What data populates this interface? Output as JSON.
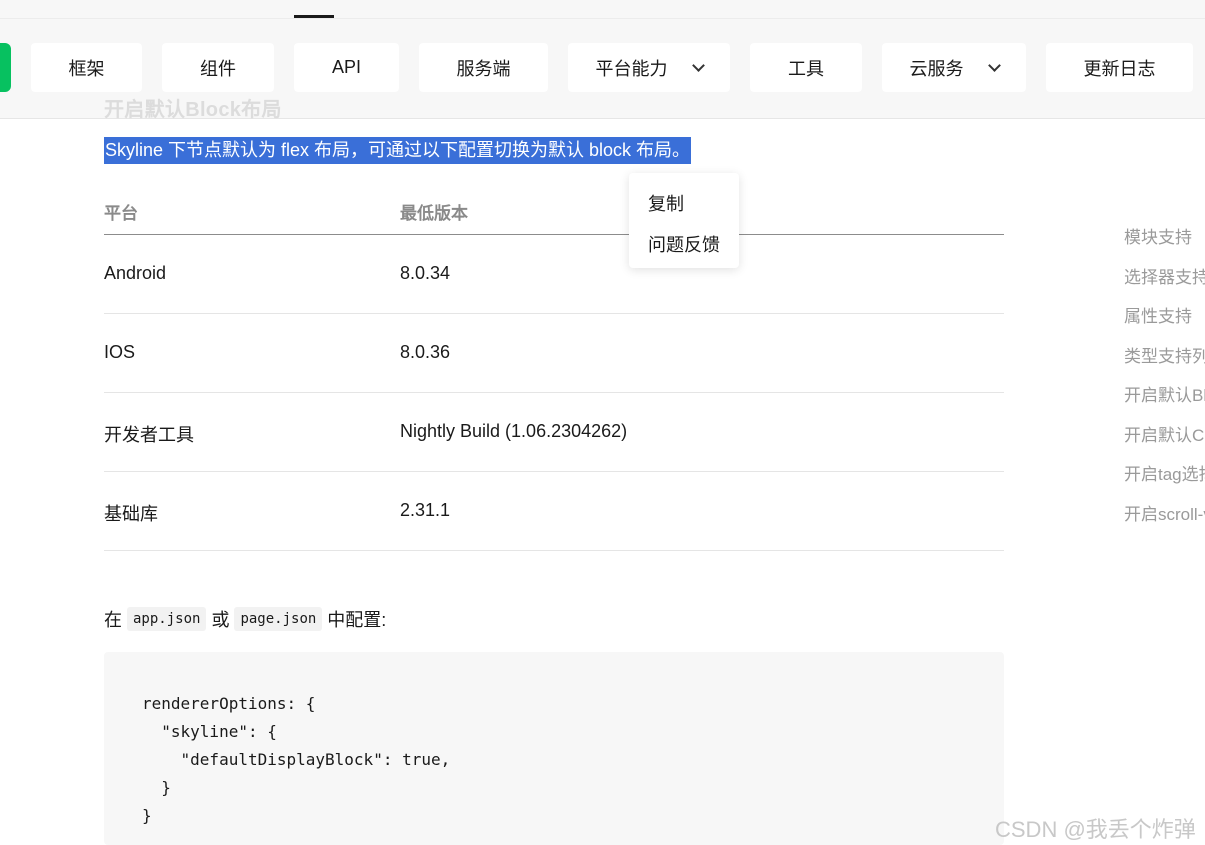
{
  "nav": {
    "items": [
      "框架",
      "组件",
      "API",
      "服务端",
      "平台能力",
      "工具",
      "云服务",
      "更新日志"
    ]
  },
  "section": {
    "ghost_heading": "开启默认Block布局",
    "selected_text": "Skyline 下节点默认为 flex 布局，可通过以下配置切换为默认 block 布局。"
  },
  "context_menu": {
    "copy": "复制",
    "feedback": "问题反馈"
  },
  "table": {
    "headers": [
      "平台",
      "最低版本"
    ],
    "rows": [
      [
        "Android",
        "8.0.34"
      ],
      [
        "IOS",
        "8.0.36"
      ],
      [
        "开发者工具",
        "Nightly Build (1.06.2304262)"
      ],
      [
        "基础库",
        "2.31.1"
      ]
    ]
  },
  "config": {
    "prefix": "在",
    "file1": "app.json",
    "or": "或",
    "file2": "page.json",
    "suffix": "中配置:"
  },
  "code": {
    "lines": [
      "rendererOptions: {",
      "  \"skyline\": {",
      "    \"defaultDisplayBlock\": true,",
      "  }",
      "}"
    ]
  },
  "toc": {
    "items": [
      "模块支持",
      "选择器支持",
      "属性支持",
      "类型支持列表",
      "开启默认Block布局",
      "开启默认ContentBox",
      "开启tag选择器",
      "开启scroll-view"
    ]
  },
  "watermark": "CSDN @我丢个炸弹",
  "colors": {
    "brand_green": "#07c160",
    "selection_blue": "#3a6fd8"
  }
}
